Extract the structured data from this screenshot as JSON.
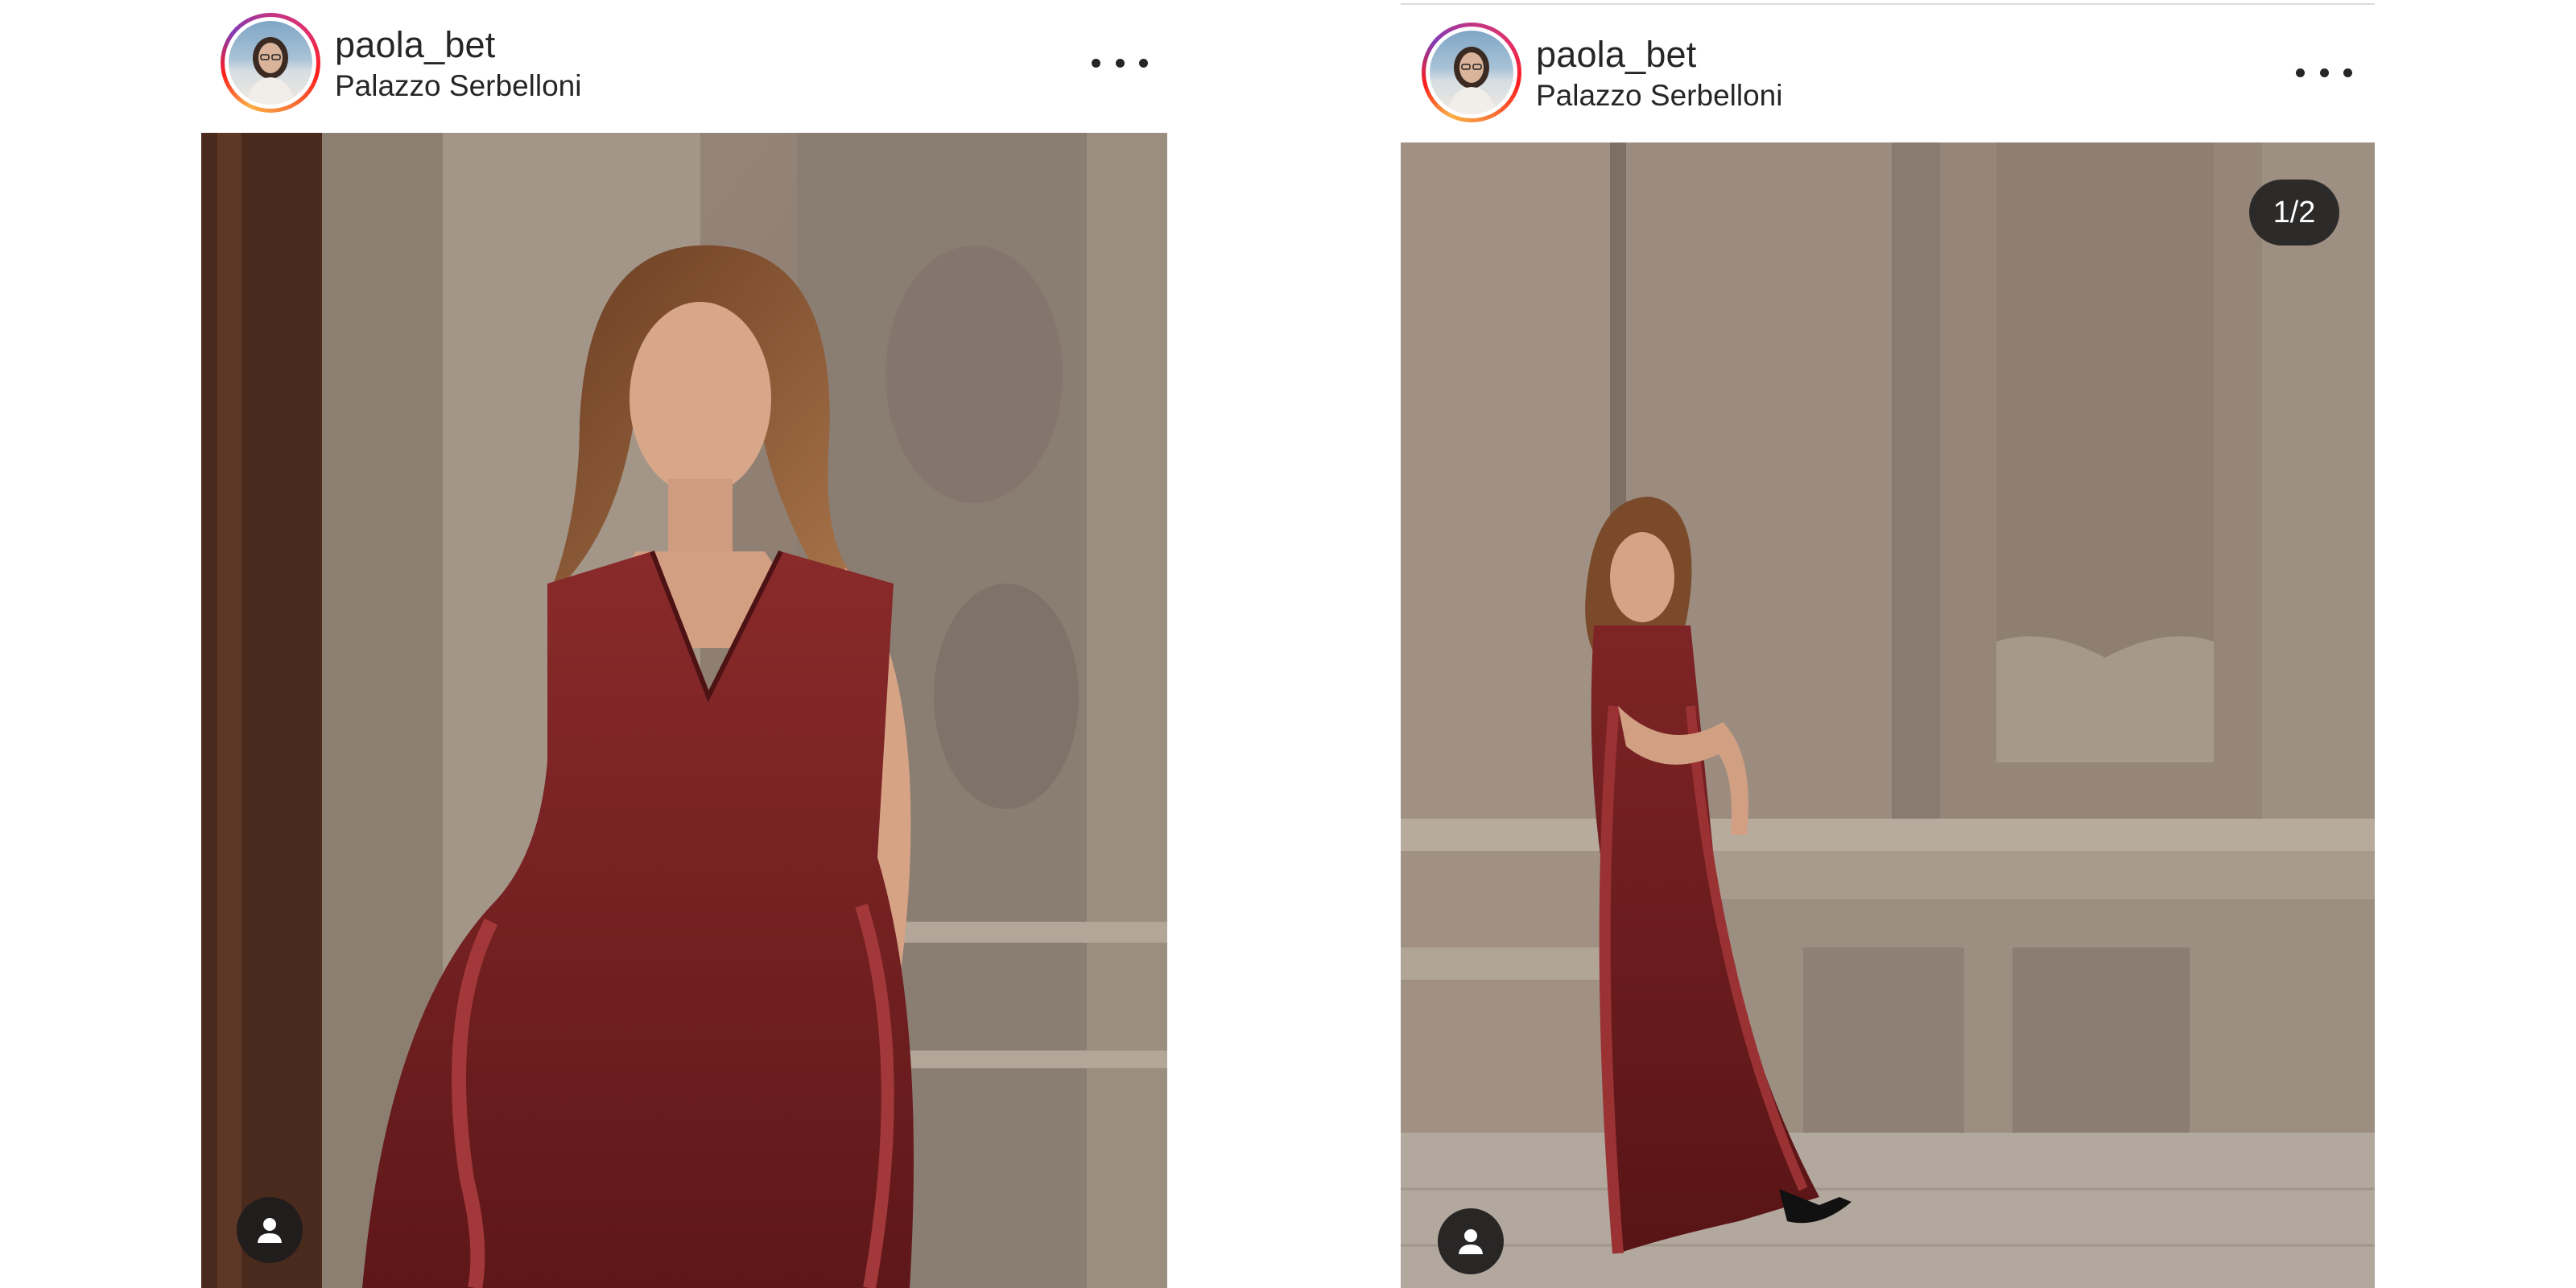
{
  "posts": [
    {
      "username": "paola_bet",
      "location": "Palazzo Serbelloni",
      "more_icon": "more-horizontal-icon",
      "user_tag_icon": "user-silhouette-icon"
    },
    {
      "username": "paola_bet",
      "location": "Palazzo Serbelloni",
      "more_icon": "more-horizontal-icon",
      "user_tag_icon": "user-silhouette-icon",
      "carousel_counter": "1/2"
    }
  ],
  "colors": {
    "text": "#262626",
    "dress": "#7a1e22",
    "story_ring_start": "#c13584",
    "story_ring_end": "#fcaf45"
  }
}
